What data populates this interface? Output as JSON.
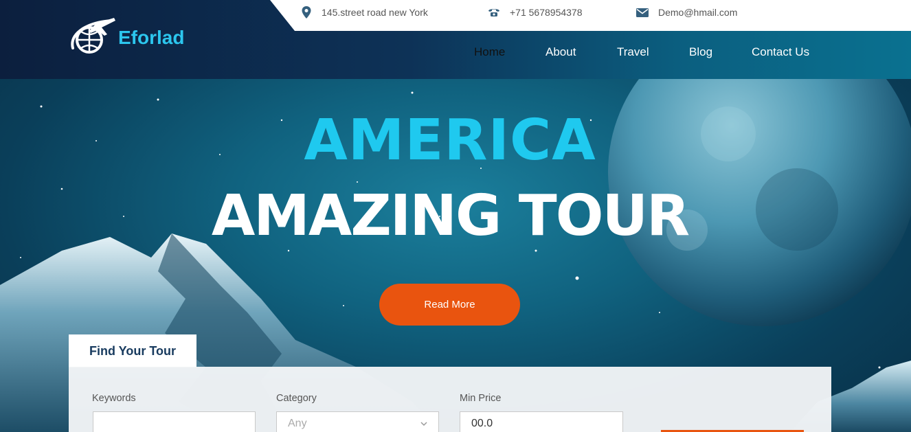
{
  "header": {
    "brand": "Eforlad",
    "contact": {
      "address": "145.street road new York",
      "phone": "+71 5678954378",
      "email": "Demo@hmail.com"
    },
    "nav": [
      {
        "label": "Home",
        "active": true
      },
      {
        "label": "About"
      },
      {
        "label": "Travel"
      },
      {
        "label": "Blog"
      },
      {
        "label": "Contact Us"
      }
    ]
  },
  "hero": {
    "title_line1": "AMERICA",
    "title_line2": "AMAZING TOUR",
    "cta_label": "Read More"
  },
  "finder": {
    "tab_label": "Find Your Tour",
    "fields": [
      {
        "label": "Keywords",
        "value": ""
      },
      {
        "label": "Category",
        "value": "Any"
      },
      {
        "label": "Min Price",
        "value": "00.0"
      }
    ]
  },
  "colors": {
    "accent": "#1fc9ef",
    "cta": "#e9540f",
    "navy": "#0c1f3e"
  }
}
